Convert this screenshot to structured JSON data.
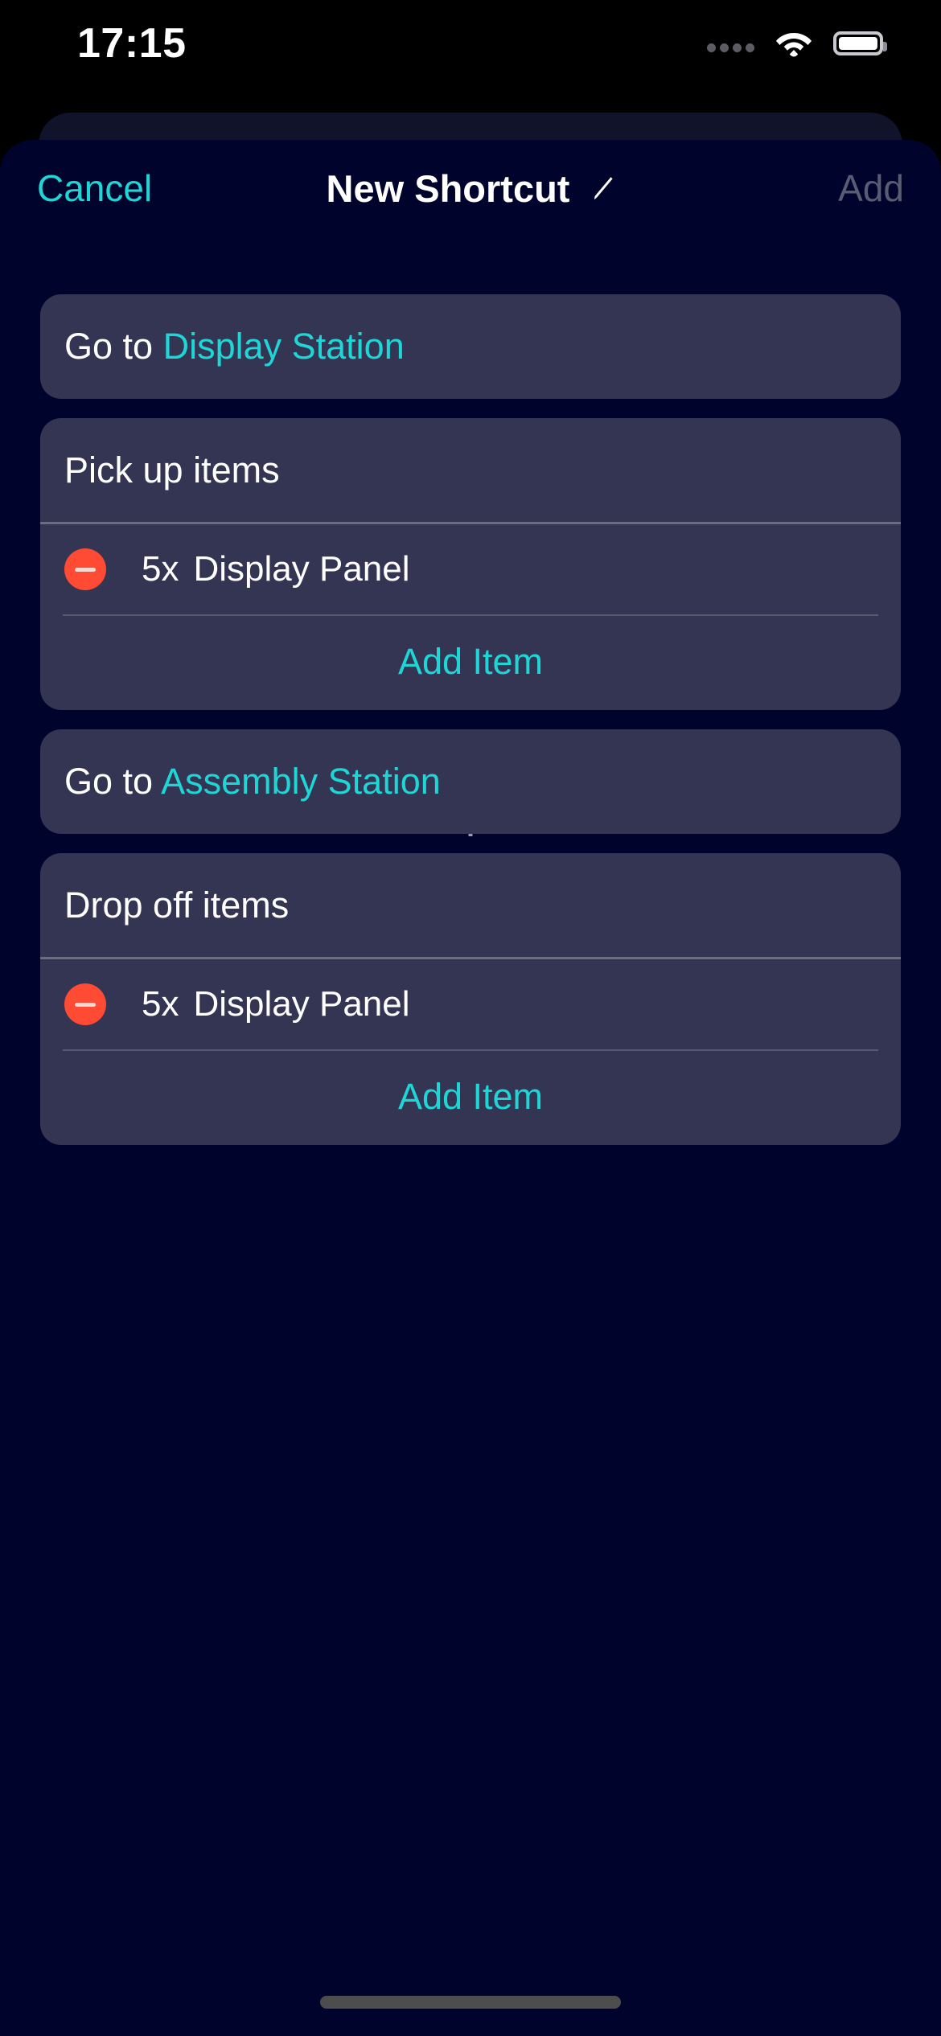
{
  "status_bar": {
    "time": "17:15",
    "icons": [
      "dots-icon",
      "wifi-icon",
      "battery-icon"
    ]
  },
  "nav": {
    "cancel_label": "Cancel",
    "title": "New Shortcut",
    "edit_icon": "pencil-icon",
    "add_label": "Add"
  },
  "colors": {
    "accent": "#1fd6d6",
    "card": "#343453",
    "sheet": "#00032b",
    "back_card": "#11132b",
    "remove": "#ff4a34",
    "disabled": "#5a5c72"
  },
  "actions": [
    {
      "type": "goto",
      "prefix": "Go to ",
      "target": "Display Station"
    },
    {
      "type": "pickup",
      "title": "Pick up items",
      "items": [
        {
          "remove_icon": "minus-circle-icon",
          "quantity": "5x",
          "name": "Display Panel"
        }
      ],
      "add_item_label": "Add Item"
    },
    {
      "type": "goto",
      "prefix": "Go to ",
      "target": "Assembly Station"
    },
    {
      "type": "dropoff",
      "title": "Drop off items",
      "items": [
        {
          "remove_icon": "minus-circle-icon",
          "quantity": "5x",
          "name": "Display Panel"
        }
      ],
      "add_item_label": "Add Item"
    }
  ]
}
